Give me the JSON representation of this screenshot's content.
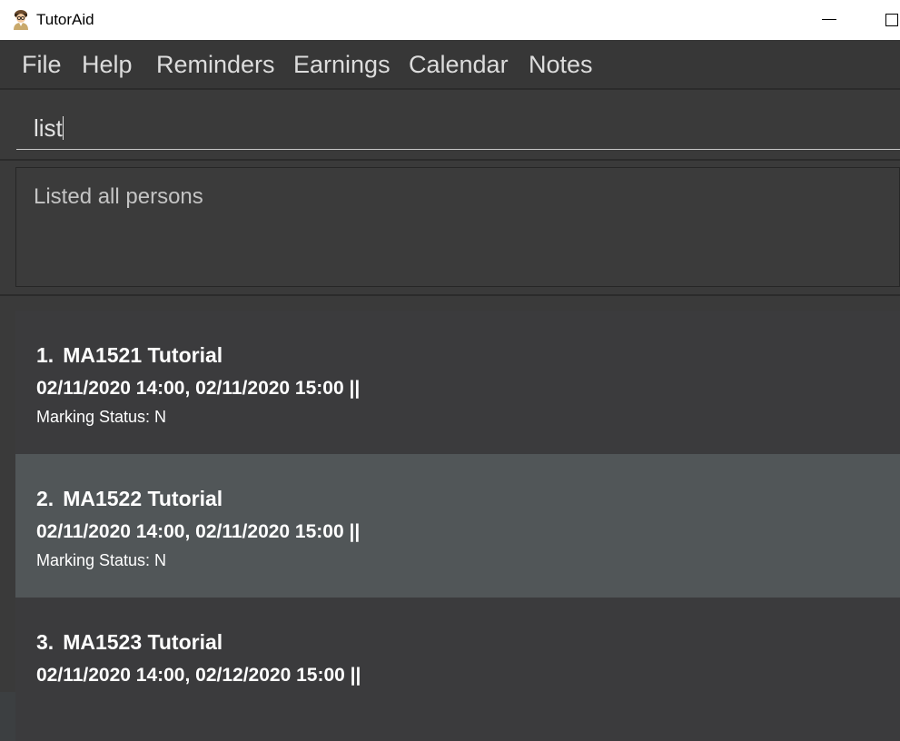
{
  "window": {
    "title": "TutorAid",
    "icon": "tutor-avatar-icon"
  },
  "menu": [
    "File",
    "Help",
    "Reminders",
    "Earnings",
    "Calendar",
    "Notes"
  ],
  "command": {
    "value": "list"
  },
  "result": {
    "message": "Listed all persons"
  },
  "lessons": [
    {
      "index": "1.",
      "title": "MA1521 Tutorial",
      "time": "02/11/2020 14:00, 02/11/2020 15:00 ||",
      "status": "Marking Status: N"
    },
    {
      "index": "2.",
      "title": "MA1522 Tutorial",
      "time": "02/11/2020 14:00, 02/11/2020 15:00 ||",
      "status": "Marking Status: N"
    },
    {
      "index": "3.",
      "title": "MA1523 Tutorial",
      "time": "02/11/2020 14:00, 02/12/2020 15:00 ||",
      "status": ""
    }
  ],
  "colors": {
    "menubar": "#373737",
    "background": "#3a3a3a",
    "card_odd": "#3b3b3d",
    "card_selected": "#515658",
    "text": "#ffffff"
  }
}
